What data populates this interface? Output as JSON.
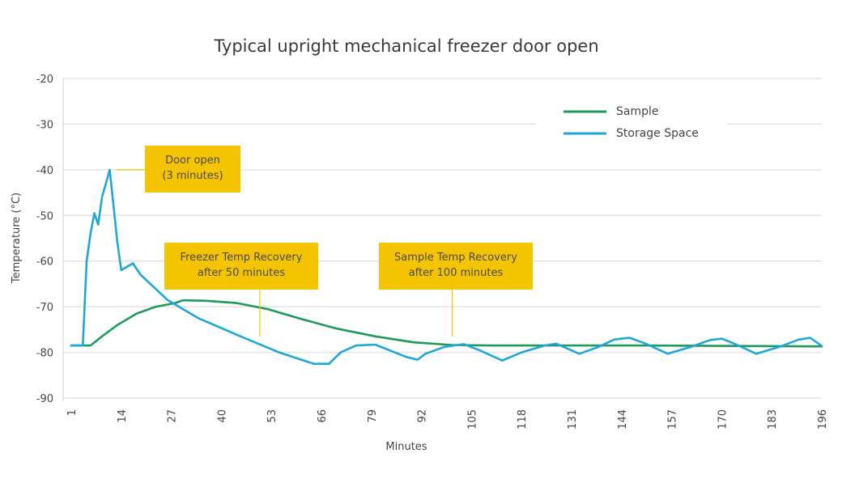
{
  "chart_data": {
    "type": "line",
    "title": "Typical upright mechanical freezer door open",
    "xlabel": "Minutes",
    "ylabel": "Temperature (°C)",
    "xlim": [
      1,
      196
    ],
    "ylim": [
      -90,
      -20
    ],
    "x_ticks": [
      1,
      14,
      27,
      40,
      53,
      66,
      79,
      92,
      105,
      118,
      131,
      144,
      157,
      170,
      183,
      196
    ],
    "y_ticks": [
      -20,
      -30,
      -40,
      -50,
      -60,
      -70,
      -80,
      -90
    ],
    "grid": true,
    "legend_position": "top-right",
    "series": [
      {
        "name": "Sample",
        "color": "#1f9a5a",
        "points": [
          [
            1,
            -78.5
          ],
          [
            6,
            -78.5
          ],
          [
            9,
            -76.5
          ],
          [
            13,
            -74
          ],
          [
            18,
            -71.5
          ],
          [
            23,
            -70
          ],
          [
            28,
            -69.2
          ],
          [
            30,
            -68.6
          ],
          [
            36,
            -68.7
          ],
          [
            44,
            -69.2
          ],
          [
            52,
            -70.5
          ],
          [
            60,
            -72.5
          ],
          [
            70,
            -74.8
          ],
          [
            80,
            -76.5
          ],
          [
            90,
            -77.8
          ],
          [
            100,
            -78.4
          ],
          [
            110,
            -78.5
          ],
          [
            150,
            -78.5
          ],
          [
            196,
            -78.7
          ]
        ]
      },
      {
        "name": "Storage Space",
        "color": "#1ea7d8",
        "points": [
          [
            1,
            -78.5
          ],
          [
            4,
            -78.5
          ],
          [
            5,
            -60
          ],
          [
            6,
            -54
          ],
          [
            7,
            -49.5
          ],
          [
            8,
            -52
          ],
          [
            9,
            -46
          ],
          [
            10,
            -43
          ],
          [
            11,
            -40
          ],
          [
            12,
            -48
          ],
          [
            13,
            -56
          ],
          [
            14,
            -62
          ],
          [
            17,
            -60.5
          ],
          [
            19,
            -63
          ],
          [
            26,
            -68.5
          ],
          [
            34,
            -72.5
          ],
          [
            45,
            -76.5
          ],
          [
            55,
            -80
          ],
          [
            64,
            -82.5
          ],
          [
            68,
            -82.5
          ],
          [
            71,
            -80
          ],
          [
            75,
            -78.5
          ],
          [
            80,
            -78.3
          ],
          [
            88,
            -81
          ],
          [
            91,
            -81.6
          ],
          [
            93,
            -80.3
          ],
          [
            98,
            -78.8
          ],
          [
            103,
            -78.2
          ],
          [
            107,
            -79.5
          ],
          [
            113,
            -81.8
          ],
          [
            118,
            -80
          ],
          [
            124,
            -78.5
          ],
          [
            127,
            -78.1
          ],
          [
            133,
            -80.3
          ],
          [
            138,
            -78.8
          ],
          [
            142,
            -77.2
          ],
          [
            146,
            -76.8
          ],
          [
            150,
            -78
          ],
          [
            156,
            -80.3
          ],
          [
            162,
            -78.8
          ],
          [
            167,
            -77.3
          ],
          [
            170,
            -77
          ],
          [
            173,
            -78
          ],
          [
            179,
            -80.3
          ],
          [
            185,
            -78.8
          ],
          [
            190,
            -77.2
          ],
          [
            193,
            -76.8
          ],
          [
            196,
            -78.6
          ]
        ]
      }
    ],
    "annotations": [
      {
        "lines": [
          "Door open",
          "(3 minutes)"
        ],
        "target": [
          11,
          -40
        ]
      },
      {
        "lines": [
          "Freezer Temp Recovery",
          "after 50 minutes"
        ],
        "target": [
          50,
          -76.5
        ]
      },
      {
        "lines": [
          "Sample Temp Recovery",
          "after 100 minutes"
        ],
        "target": [
          100,
          -76.5
        ]
      }
    ],
    "annotation_color": "#f5c400"
  }
}
